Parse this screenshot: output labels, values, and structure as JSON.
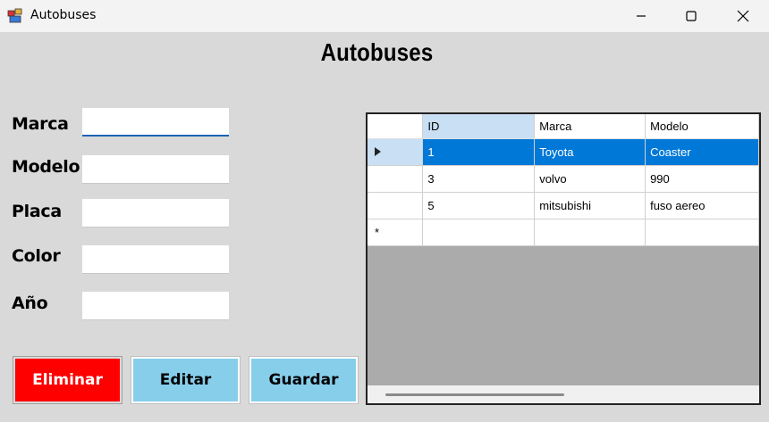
{
  "window": {
    "title": "Autobuses",
    "controls": [
      "minimize-icon",
      "maximize-icon",
      "close-icon"
    ]
  },
  "form": {
    "heading": "Autobuses",
    "fields": [
      {
        "label": "Marca",
        "value": "",
        "focused": true
      },
      {
        "label": "Modelo",
        "value": ""
      },
      {
        "label": "Placa",
        "value": ""
      },
      {
        "label": "Color",
        "value": ""
      },
      {
        "label": "Año",
        "value": ""
      }
    ]
  },
  "buttons": {
    "eliminar": "Eliminar",
    "editar": "Editar",
    "guardar": "Guardar"
  },
  "grid": {
    "columns": [
      "ID",
      "Marca",
      "Modelo"
    ],
    "rows": [
      {
        "id": "1",
        "marca": "Toyota",
        "modelo": "Coaster",
        "selected": true
      },
      {
        "id": "3",
        "marca": "volvo",
        "modelo": "990"
      },
      {
        "id": "5",
        "marca": "mitsubishi",
        "modelo": "fuso aereo"
      }
    ],
    "new_row_marker": "*"
  },
  "colors": {
    "eliminar_bg": "#ff0000",
    "button_bg": "#87ceeb",
    "selection": "#0078d7",
    "form_bg": "#d9d9d9"
  }
}
